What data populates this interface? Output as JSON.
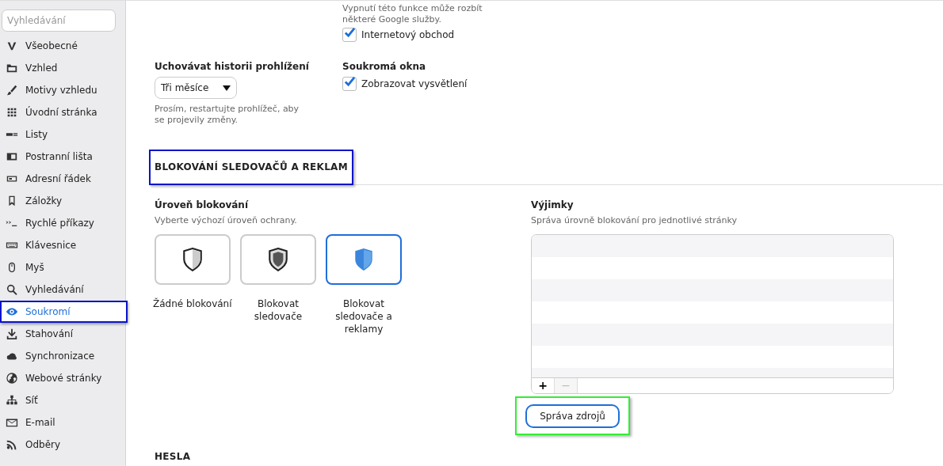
{
  "sidebar": {
    "search": {
      "placeholder": "Vyhledávání"
    },
    "items": [
      {
        "label": "Všeobecné",
        "selected": false,
        "highlighted": false
      },
      {
        "label": "Vzhled",
        "selected": false,
        "highlighted": false
      },
      {
        "label": "Motivy vzhledu",
        "selected": false,
        "highlighted": false
      },
      {
        "label": "Úvodní stránka",
        "selected": false,
        "highlighted": false
      },
      {
        "label": "Listy",
        "selected": false,
        "highlighted": false
      },
      {
        "label": "Postranní lišta",
        "selected": false,
        "highlighted": false
      },
      {
        "label": "Adresní řádek",
        "selected": false,
        "highlighted": false
      },
      {
        "label": "Záložky",
        "selected": false,
        "highlighted": false
      },
      {
        "label": "Rychlé příkazy",
        "selected": false,
        "highlighted": false
      },
      {
        "label": "Klávesnice",
        "selected": false,
        "highlighted": false
      },
      {
        "label": "Myš",
        "selected": false,
        "highlighted": false
      },
      {
        "label": "Vyhledávání",
        "selected": false,
        "highlighted": false
      },
      {
        "label": "Soukromí",
        "selected": true,
        "highlighted": true
      },
      {
        "label": "Stahování",
        "selected": false,
        "highlighted": false
      },
      {
        "label": "Synchronizace",
        "selected": false,
        "highlighted": false
      },
      {
        "label": "Webové stránky",
        "selected": false,
        "highlighted": false
      },
      {
        "label": "Síť",
        "selected": false,
        "highlighted": false
      },
      {
        "label": "E-mail",
        "selected": false,
        "highlighted": false
      },
      {
        "label": "Odběry",
        "selected": false,
        "highlighted": false
      }
    ]
  },
  "top": {
    "note": "Vypnutí této funkce může rozbít některé Google služby.",
    "checkbox": {
      "label": "Internetový obchod",
      "checked": true
    }
  },
  "history": {
    "label": "Uchovávat historii prohlížení",
    "select": {
      "value": "Tři měsíce"
    },
    "note": "Prosím, restartujte prohlížeč, aby se projevily změny."
  },
  "private_windows": {
    "label": "Soukromá okna",
    "checkbox": {
      "label": "Zobrazovat vysvětlení",
      "checked": true
    }
  },
  "section": {
    "heading": "BLOKOVÁNÍ SLEDOVAČŮ A REKLAM",
    "highlighted": true
  },
  "blocking_level": {
    "label": "Úroveň blokování",
    "description": "Vyberte výchozí úroveň ochrany.",
    "options": [
      {
        "kind": "none",
        "label": "Žádné blokování",
        "selected": false
      },
      {
        "kind": "trackers",
        "label": "Blokovat sledovače",
        "selected": false
      },
      {
        "kind": "all",
        "label": "Blokovat sledovače a reklamy",
        "selected": true
      }
    ]
  },
  "exceptions": {
    "label": "Výjimky",
    "description": "Správa úrovně blokování pro jednotlivé stránky",
    "add_button": "+",
    "remove_button": {
      "label": "−",
      "disabled": true
    }
  },
  "manage_button": {
    "label": "Správa zdrojů",
    "highlighted": true
  },
  "next_section": {
    "heading": "HESLA"
  }
}
